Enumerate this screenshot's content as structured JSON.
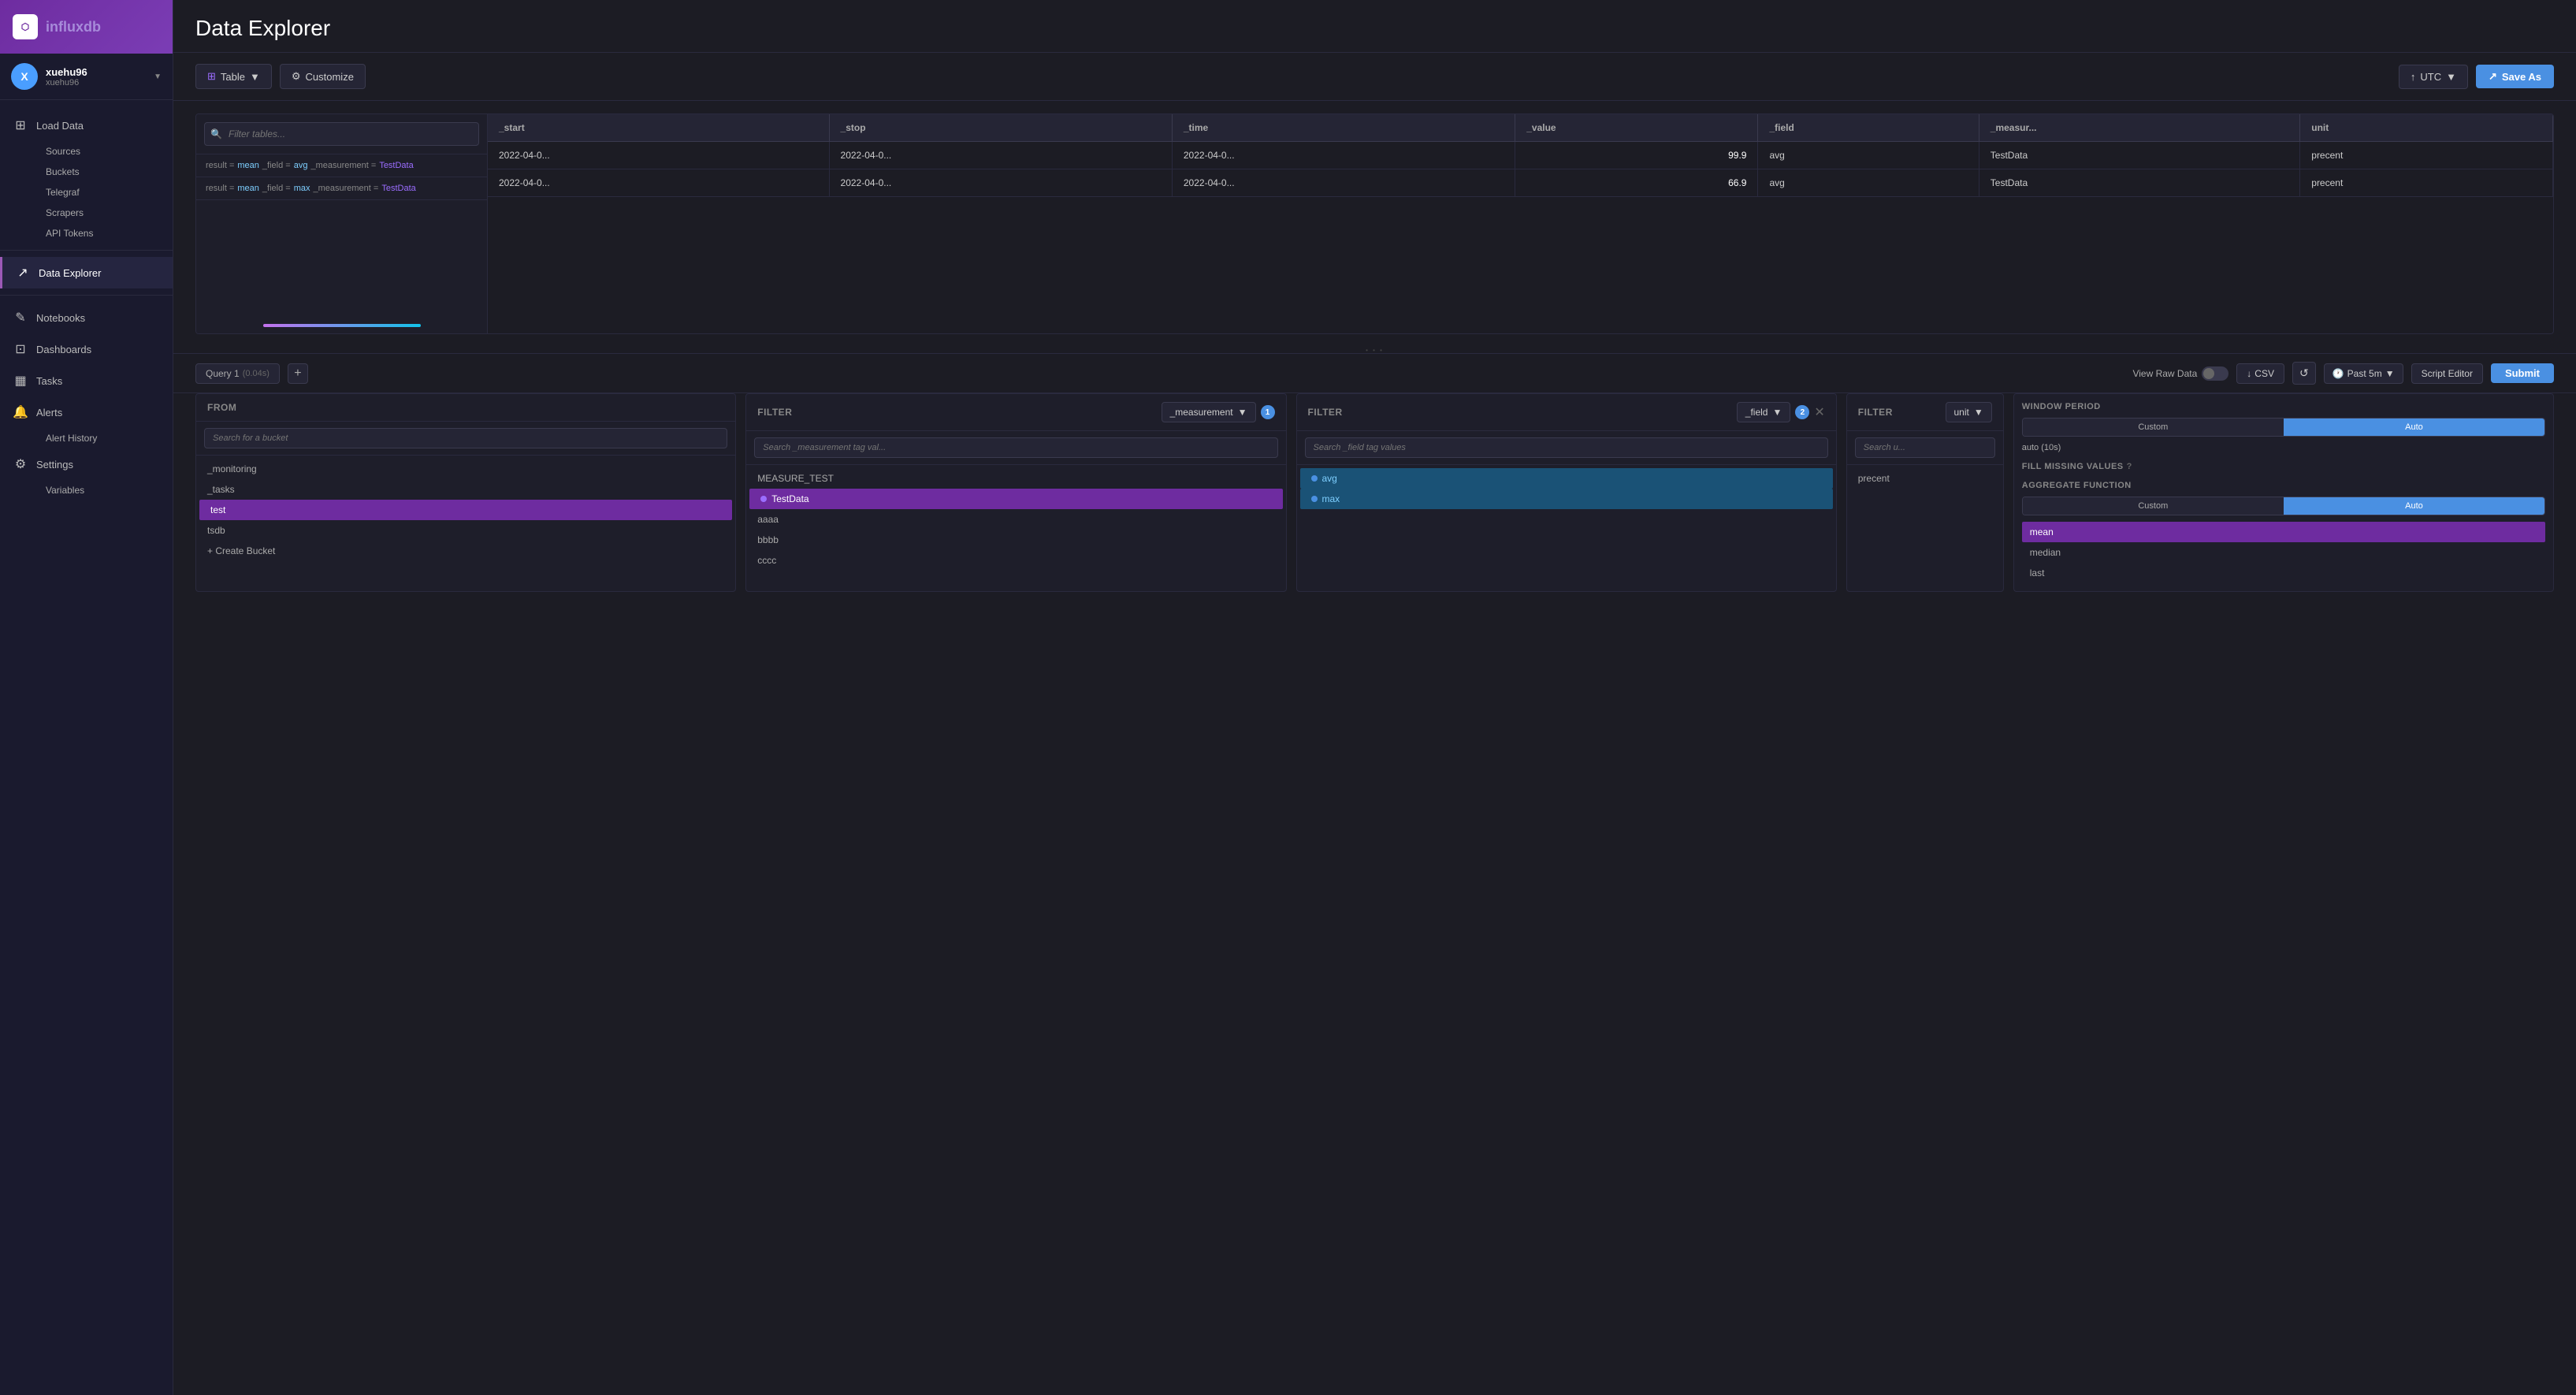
{
  "app": {
    "logo_text1": "influx",
    "logo_text2": "db"
  },
  "user": {
    "name": "xuehu96",
    "email": "xuehu96",
    "avatar_initials": "X"
  },
  "sidebar": {
    "nav_items": [
      {
        "id": "load-data",
        "label": "Load Data",
        "icon": "⊞"
      },
      {
        "id": "data-explorer",
        "label": "Data Explorer",
        "icon": "↗",
        "active": true
      },
      {
        "id": "notebooks",
        "label": "Notebooks",
        "icon": "✏"
      },
      {
        "id": "dashboards",
        "label": "Dashboards",
        "icon": "⊡"
      },
      {
        "id": "tasks",
        "label": "Tasks",
        "icon": "📅"
      },
      {
        "id": "alerts",
        "label": "Alerts",
        "icon": "🔔"
      },
      {
        "id": "settings",
        "label": "Settings",
        "icon": "⚙"
      }
    ],
    "load_data_sub": [
      "Sources",
      "Buckets",
      "Telegraf",
      "Scrapers",
      "API Tokens"
    ],
    "alerts_sub": [
      "Alert History"
    ],
    "settings_sub": [
      "Variables"
    ]
  },
  "page": {
    "title": "Data Explorer"
  },
  "toolbar": {
    "table_label": "Table",
    "customize_label": "Customize",
    "utc_label": "UTC",
    "save_as_label": "Save As"
  },
  "filter_tables": {
    "placeholder": "Filter tables..."
  },
  "table_rows": [
    {
      "result": "mean",
      "field": "avg",
      "measurement": "TestData"
    },
    {
      "result": "mean",
      "field": "max",
      "measurement": "TestData"
    }
  ],
  "data_table": {
    "columns": [
      "_start",
      "_stop",
      "_time",
      "_value",
      "_field",
      "_measur...",
      "unit"
    ],
    "rows": [
      {
        "start": "2022-04-0...",
        "stop": "2022-04-0...",
        "time": "2022-04-0...",
        "value": "99.9",
        "field": "avg",
        "measurement": "TestData",
        "unit": "precent"
      },
      {
        "start": "2022-04-0...",
        "stop": "2022-04-0...",
        "time": "2022-04-0...",
        "value": "66.9",
        "field": "avg",
        "measurement": "TestData",
        "unit": "precent"
      }
    ]
  },
  "query_bar": {
    "query_label": "Query 1",
    "query_time": "(0.04s)",
    "view_raw_label": "View Raw Data",
    "csv_label": "CSV",
    "time_label": "Past 5m",
    "script_editor_label": "Script Editor",
    "submit_label": "Submit"
  },
  "from_panel": {
    "title": "FROM",
    "search_placeholder": "Search for a bucket",
    "items": [
      "_monitoring",
      "_tasks",
      "test",
      "tsdb",
      "+ Create Bucket"
    ],
    "selected": "test"
  },
  "filter1_panel": {
    "title": "Filter",
    "field": "_measurement",
    "badge": "1",
    "search_placeholder": "Search _measurement tag val...",
    "items": [
      "MEASURE_TEST",
      "TestData",
      "aaaa",
      "bbbb",
      "cccc"
    ],
    "selected": "TestData"
  },
  "filter2_panel": {
    "title": "Filter",
    "field": "_field",
    "badge": "2",
    "search_placeholder": "Search _field tag values",
    "items": [
      "avg",
      "max"
    ],
    "selected_items": [
      "avg",
      "max"
    ]
  },
  "filter3_panel": {
    "title": "Filter",
    "field": "unit",
    "search_placeholder": "Search u...",
    "items": [
      "precent"
    ]
  },
  "window_panel": {
    "title": "WINDOW PERIOD",
    "custom_label": "Custom",
    "auto_label": "Auto",
    "auto_text": "auto (10s)",
    "fill_title": "Fill missing values",
    "agg_title": "AGGREGATE FUNCTION",
    "agg_custom_label": "Custom",
    "agg_auto_label": "Auto",
    "agg_items": [
      "mean",
      "median",
      "last"
    ],
    "agg_selected": "mean"
  }
}
